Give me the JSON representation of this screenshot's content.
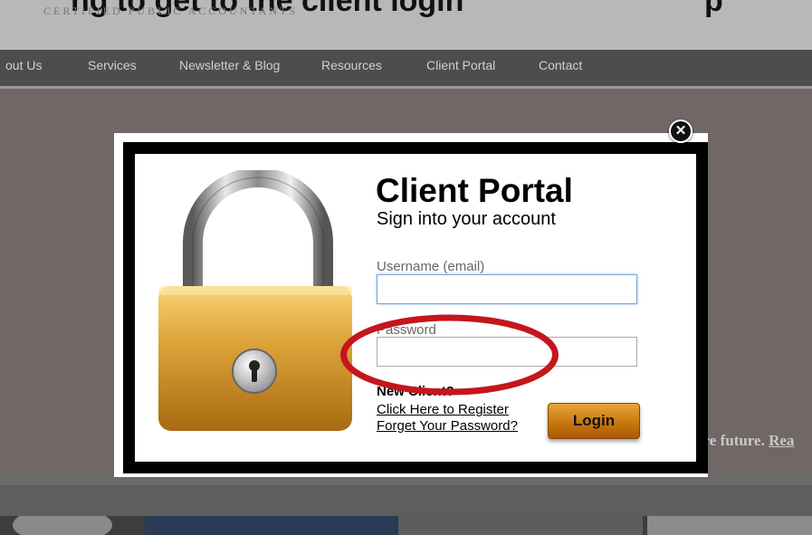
{
  "background": {
    "heading": "ng to get to the client login",
    "heading_right": "p",
    "tagline": "CERTIFIED PUBLIC ACCOUNTANTS",
    "nav": [
      "out Us",
      "Services",
      "Newsletter & Blog",
      "Resources",
      "Client Portal",
      "Contact"
    ],
    "hero_text": "ecure future.",
    "hero_link": "Rea"
  },
  "modal": {
    "close_glyph": "✕",
    "title": "Client Portal",
    "subtitle": "Sign into your account",
    "username_label": "Username (email)",
    "username_value": "",
    "password_label": "Password",
    "password_value": "",
    "new_client": "New Client?",
    "register_link": "Click Here to Register",
    "forgot_link": "Forget Your Password?",
    "login_button": "Login"
  },
  "icons": {
    "padlock": "padlock-icon",
    "close": "close-icon"
  },
  "colors": {
    "annotation": "#c4161c",
    "login_button": "#c5740d",
    "field_focus": "#7aa7d6"
  }
}
